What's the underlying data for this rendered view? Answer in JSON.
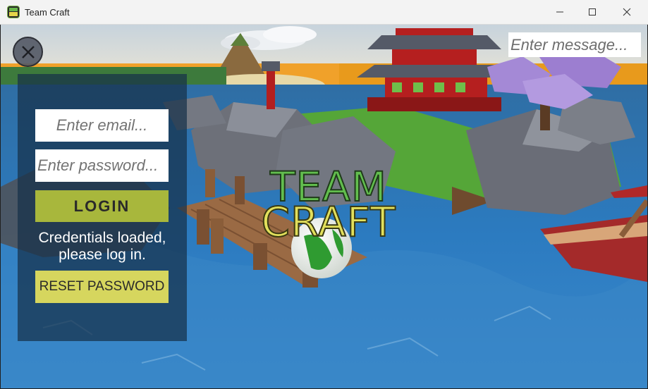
{
  "window": {
    "title": "Team Craft",
    "icon": "team-craft-app-icon",
    "controls": [
      "minimize-icon",
      "maximize-icon",
      "close-icon"
    ]
  },
  "game": {
    "logo_line1": "TEAM",
    "logo_line2": "CRAFT",
    "menu_close_icon": "x-circle-icon"
  },
  "chat": {
    "placeholder": "Enter message..."
  },
  "login": {
    "email_placeholder": "Enter email...",
    "password_placeholder": "Enter password...",
    "login_label": "LOGIN",
    "status_text": "Credentials loaded, please log in.",
    "reset_label": "RESET PASSWORD"
  },
  "colors": {
    "login_button": "#a8b73c",
    "reset_button": "#d6d65e",
    "panel": "#16304a",
    "logo_green": "#62be4e",
    "logo_yellow": "#e2e05c"
  }
}
